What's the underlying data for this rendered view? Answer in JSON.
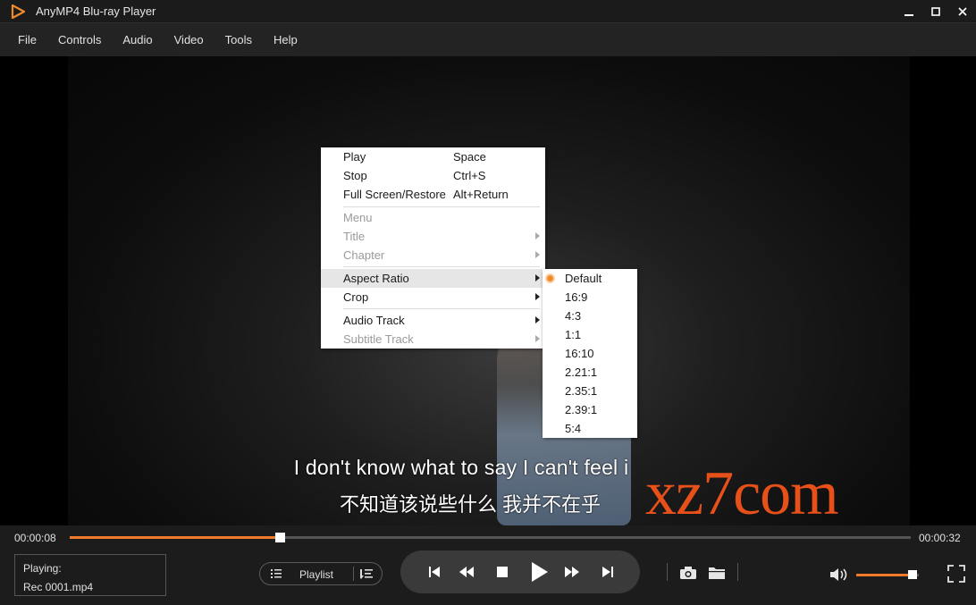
{
  "app": {
    "title": "AnyMP4 Blu-ray Player",
    "accent": "#f07b2a"
  },
  "menubar": {
    "items": [
      "File",
      "Controls",
      "Audio",
      "Video",
      "Tools",
      "Help"
    ]
  },
  "video": {
    "subtitle_en": "I don't know what to say I can't feel i",
    "subtitle_cn": "不知道该说些什么 我并不在乎",
    "watermark": "xz7com"
  },
  "context_menu": {
    "play": {
      "label": "Play",
      "shortcut": "Space"
    },
    "stop": {
      "label": "Stop",
      "shortcut": "Ctrl+S"
    },
    "fullscreen": {
      "label": "Full Screen/Restore",
      "shortcut": "Alt+Return"
    },
    "menu": {
      "label": "Menu"
    },
    "title": {
      "label": "Title"
    },
    "chapter": {
      "label": "Chapter"
    },
    "aspect_ratio": {
      "label": "Aspect Ratio"
    },
    "crop": {
      "label": "Crop"
    },
    "audio_track": {
      "label": "Audio Track"
    },
    "subtitle_track": {
      "label": "Subtitle Track"
    }
  },
  "aspect_submenu": {
    "selected": "Default",
    "options": [
      "Default",
      "16:9",
      "4:3",
      "1:1",
      "16:10",
      "2.21:1",
      "2.35:1",
      "2.39:1",
      "5:4"
    ]
  },
  "playback": {
    "current_time": "00:00:08",
    "total_time": "00:00:32",
    "progress": 0.25,
    "volume": 0.9
  },
  "now_playing": {
    "label": "Playing:",
    "file": "Rec 0001.mp4"
  },
  "playlist": {
    "label": "Playlist"
  }
}
